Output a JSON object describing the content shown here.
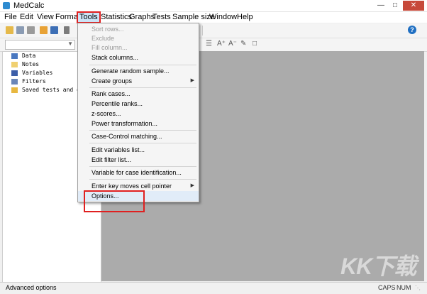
{
  "window": {
    "title": "MedCalc"
  },
  "menubar": [
    "File",
    "Edit",
    "View",
    "Format",
    "Tools",
    "Statistics",
    "Graphs",
    "Tests",
    "Sample size",
    "Window",
    "Help"
  ],
  "help_glyph": "?",
  "sidebar": {
    "items": [
      {
        "label": "Data",
        "icon": "data-grid-icon"
      },
      {
        "label": "Notes",
        "icon": "notes-icon"
      },
      {
        "label": "Variables",
        "icon": "variables-icon"
      },
      {
        "label": "Filters",
        "icon": "filter-icon"
      },
      {
        "label": "Saved tests and graphs",
        "icon": "folder-icon"
      }
    ]
  },
  "tools_menu": {
    "items": [
      {
        "label": "Sort rows...",
        "disabled": true
      },
      {
        "label": "Exclude",
        "disabled": true
      },
      {
        "label": "Fill column...",
        "disabled": true
      },
      {
        "label": "Stack columns...",
        "disabled": false
      },
      {
        "label": "Generate random sample...",
        "disabled": false
      },
      {
        "label": "Create groups",
        "disabled": false,
        "submenu": true
      },
      {
        "label": "Rank cases...",
        "disabled": false
      },
      {
        "label": "Percentile ranks...",
        "disabled": false
      },
      {
        "label": "z-scores...",
        "disabled": false
      },
      {
        "label": "Power transformation...",
        "disabled": false
      },
      {
        "label": "Case-Control matching...",
        "disabled": false
      },
      {
        "label": "Edit variables list...",
        "disabled": false
      },
      {
        "label": "Edit filter list...",
        "disabled": false
      },
      {
        "label": "Variable for case identification...",
        "disabled": false
      },
      {
        "label": "Enter key moves cell pointer",
        "disabled": false,
        "submenu": true
      },
      {
        "label": "Options...",
        "disabled": false
      }
    ],
    "submenu_glyph": "▶"
  },
  "statusbar": {
    "text": "Advanced options",
    "caps": "CAPS",
    "num": "NUM"
  },
  "watermark": "KK下载",
  "colors": {
    "highlight": "#e02020",
    "workarea": "#ababab"
  }
}
